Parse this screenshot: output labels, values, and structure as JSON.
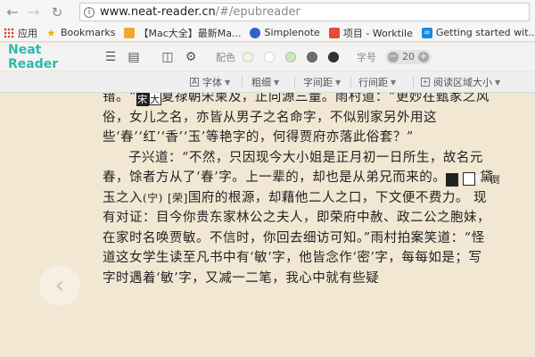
{
  "browser": {
    "url_host": "www.neat-reader.cn",
    "url_path": "/#/epubreader",
    "bookmarks": [
      {
        "label": "应用",
        "icon": "apps-icon"
      },
      {
        "label": "Bookmarks",
        "icon": "star-icon"
      },
      {
        "label": "【Mac大全】最新Ma...",
        "icon": "folder-icon"
      },
      {
        "label": "Simplenote",
        "icon": "simplenote-icon"
      },
      {
        "label": "项目 - Worktile",
        "icon": "worktile-icon"
      },
      {
        "label": "Getting started wit...",
        "icon": "infinity-icon"
      }
    ]
  },
  "toolbar": {
    "brand": "Neat Reader",
    "color_label": "配色",
    "swatches": [
      "#f6f1e2",
      "#ffffff",
      "#c9e9c1",
      "#6e6e6e",
      "#333333"
    ],
    "size_label": "字号",
    "size_value": "20",
    "minus": "−",
    "plus": "+"
  },
  "toolbar2": {
    "font": "字体",
    "weight": "粗细",
    "char_spacing": "字间距",
    "line_spacing": "行间距",
    "area_size": "阅读区域大小"
  },
  "reader": {
    "lines": {
      "l1a": "错。“",
      "g1": "宋",
      "g2": "大",
      "l1b": "夏禄朝宋柬及，正向源三量。雨村道：“更妙",
      "l2": "在甄家之风俗，女儿之名，亦皆从男子之名命字，不似别家另外用这些‘春’‘红’‘香’‘玉’等艳字的，何得贾府亦落此俗套？”",
      "p2": "子兴道：“不然，只因现今大小姐是正月初一日所生，故名元春，馀者方从了‘春’字。上一辈的，却也是从弟兄而来的。",
      "g3": "賈",
      "g4": "倒",
      "p2b": " 黛玉之入",
      "note1": "(宁)",
      "p2c": " ",
      "note2": "[荣]",
      "p2d": "国府的根源，却藉他二人之口，下文便不费力。 现有对证：目今你贵东家林公之夫人，即荣府中赦、政二公之胞妹，在家时名唤贾敏。不信时，你回去细访可知。”雨村拍案笑道：“怪道这女学生读至凡书中有‘敏’字，他皆念作‘密’字，每每如是；写字时遇着‘敏’字，又减一二笔，我心中就有些疑"
    },
    "prev_arrow": "‹"
  }
}
